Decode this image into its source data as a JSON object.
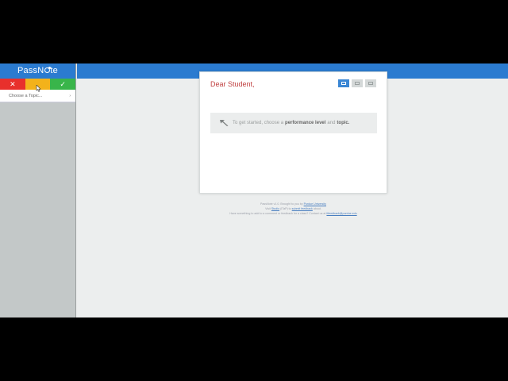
{
  "sidebar": {
    "logo_text_pre": "PassN",
    "logo_text_post": "te",
    "levels": [
      {
        "symbol": "✕",
        "color": "#e8302c"
      },
      {
        "symbol": "",
        "color": "#f3b21b"
      },
      {
        "symbol": "✓",
        "color": "#39b54a"
      }
    ],
    "topic_select": {
      "placeholder": "Choose a Topic...",
      "chevron": "›"
    }
  },
  "card": {
    "title": "Dear Student,",
    "prompt": {
      "pre": "To get started, choose a",
      "level": "performance level",
      "and": "and",
      "topic": "topic."
    }
  },
  "footer": {
    "line1_pre": "PassNote v1.0. Brought to you by",
    "line1_link": "Purdue University",
    "line2_pre": "Visit",
    "line2_link1": "Studio",
    "line2_mid": "(ITaP) to",
    "line2_link2": "submit feedback",
    "line2_post": "about.",
    "line3_pre": "Have something to add to a comment or feedback for a class? Contact us at",
    "line3_link": "itfeedback@purdue.edu"
  },
  "colors": {
    "brand_blue": "#2b7bd0",
    "sidebar_bg": "#c3c8c8",
    "title_red": "#c04040"
  }
}
